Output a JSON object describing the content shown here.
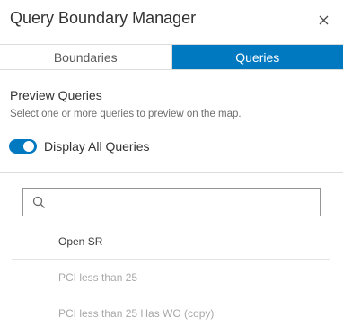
{
  "header": {
    "title": "Query Boundary Manager",
    "close_icon": "close-icon"
  },
  "tabs": [
    {
      "label": "Boundaries",
      "active": false
    },
    {
      "label": "Queries",
      "active": true
    }
  ],
  "preview": {
    "title": "Preview Queries",
    "description": "Select one or more queries to preview on the map.",
    "toggle": {
      "label": "Display All Queries",
      "on": true
    }
  },
  "search": {
    "placeholder": "",
    "value": "",
    "icon": "search-icon"
  },
  "queries": [
    {
      "label": "Open SR",
      "enabled": true
    },
    {
      "label": "PCI less than 25",
      "enabled": false
    },
    {
      "label": "PCI less than 25 Has WO (copy)",
      "enabled": false
    }
  ],
  "colors": {
    "accent": "#0079c1",
    "text": "#323232",
    "muted": "#6e6e6e",
    "disabled": "#a8a8a8",
    "border": "#dcdcdc"
  }
}
